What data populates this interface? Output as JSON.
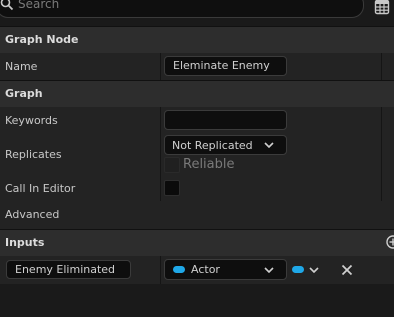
{
  "search": {
    "placeholder": "Search",
    "value": ""
  },
  "sections": {
    "graph_node": "Graph Node",
    "graph": "Graph",
    "inputs": "Inputs"
  },
  "graph_node": {
    "name_label": "Name",
    "name_value": "Eleminate Enemy"
  },
  "graph": {
    "keywords_label": "Keywords",
    "keywords_value": "",
    "replicates_label": "Replicates",
    "replicates_value": "Not Replicated",
    "reliable_label": "Reliable",
    "call_in_editor_label": "Call In Editor",
    "advanced_label": "Advanced"
  },
  "inputs": {
    "param_name": "Enemy Eliminated",
    "param_type": "Actor"
  },
  "colors": {
    "pin_accent": "#1fa8e8",
    "header_bg": "#2d2d2d",
    "row_bg": "#232323"
  },
  "icons": [
    "search-icon",
    "grid-view-icon",
    "chevron-down-icon",
    "add-circle-icon",
    "close-icon"
  ]
}
